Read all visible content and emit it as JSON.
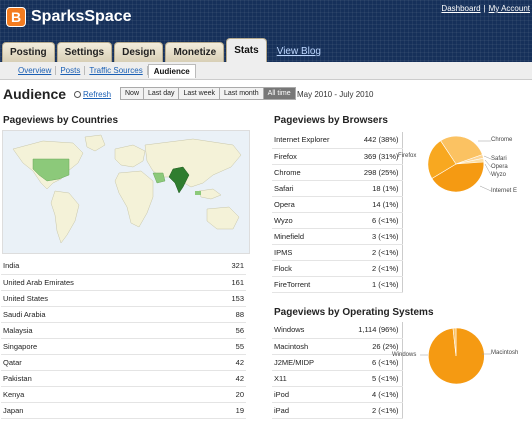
{
  "header": {
    "logo_letter": "B",
    "brand": "SparksSpace",
    "links": [
      "Dashboard",
      "My Account"
    ],
    "tabs": [
      "Posting",
      "Settings",
      "Design",
      "Monetize",
      "Stats"
    ],
    "active_tab": "Stats",
    "view_blog": "View Blog"
  },
  "subnav": {
    "items": [
      "Overview",
      "Posts",
      "Traffic Sources",
      "Audience"
    ],
    "active": "Audience"
  },
  "page": {
    "title": "Audience",
    "refresh": "Refresh",
    "ranges": [
      "Now",
      "Last day",
      "Last week",
      "Last month",
      "All time"
    ],
    "active_range": "All time",
    "date_range": "May 2010 - July 2010"
  },
  "countries": {
    "title": "Pageviews by Countries",
    "rows": [
      {
        "name": "India",
        "value": "321"
      },
      {
        "name": "United Arab Emirates",
        "value": "161"
      },
      {
        "name": "United States",
        "value": "153"
      },
      {
        "name": "Saudi Arabia",
        "value": "88"
      },
      {
        "name": "Malaysia",
        "value": "56"
      },
      {
        "name": "Singapore",
        "value": "55"
      },
      {
        "name": "Qatar",
        "value": "42"
      },
      {
        "name": "Pakistan",
        "value": "42"
      },
      {
        "name": "Kenya",
        "value": "20"
      },
      {
        "name": "Japan",
        "value": "19"
      }
    ]
  },
  "browsers": {
    "title": "Pageviews by Browsers",
    "rows": [
      {
        "name": "Internet Explorer",
        "value": "442 (38%)"
      },
      {
        "name": "Firefox",
        "value": "369 (31%)"
      },
      {
        "name": "Chrome",
        "value": "298 (25%)"
      },
      {
        "name": "Safari",
        "value": "18 (1%)"
      },
      {
        "name": "Opera",
        "value": "14 (1%)"
      },
      {
        "name": "Wyzo",
        "value": "6 (<1%)"
      },
      {
        "name": "Minefield",
        "value": "3 (<1%)"
      },
      {
        "name": "IPMS",
        "value": "2 (<1%)"
      },
      {
        "name": "Flock",
        "value": "2 (<1%)"
      },
      {
        "name": "FireTorrent",
        "value": "1 (<1%)"
      }
    ],
    "pie_labels": {
      "firefox": "Firefox",
      "chrome": "Chrome",
      "safari": "Safari",
      "opera": "Opera",
      "wyzo": "Wyzo",
      "ie": "Internet E"
    }
  },
  "os": {
    "title": "Pageviews by Operating Systems",
    "rows": [
      {
        "name": "Windows",
        "value": "1,114 (96%)"
      },
      {
        "name": "Macintosh",
        "value": "26 (2%)"
      },
      {
        "name": "J2ME/MIDP",
        "value": "6 (<1%)"
      },
      {
        "name": "X11",
        "value": "5 (<1%)"
      },
      {
        "name": "iPod",
        "value": "4 (<1%)"
      },
      {
        "name": "iPad",
        "value": "2 (<1%)"
      }
    ],
    "pie_labels": {
      "windows": "Windows",
      "mac": "Macintosh"
    }
  },
  "colors": {
    "header_bg": "#16305a",
    "pie_primary": "#f59a12",
    "pie_light": "#fbc262",
    "map_highlight": "#2f7d2f",
    "map_mid": "#8cc97a"
  }
}
